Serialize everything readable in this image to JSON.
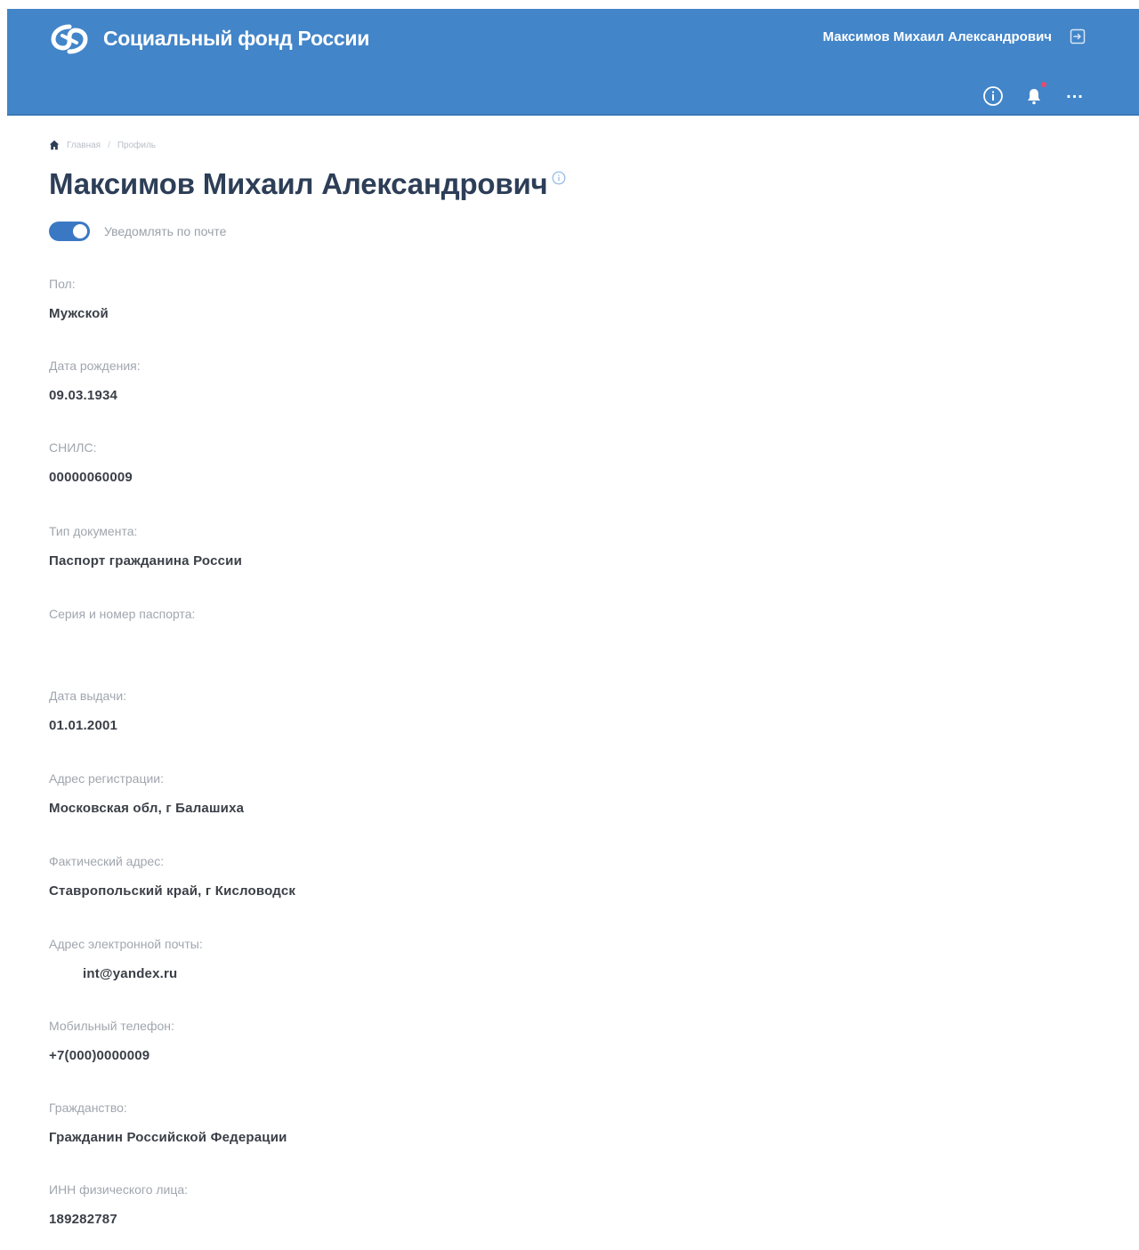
{
  "header": {
    "brand": "Социальный фонд России",
    "user_name": "Максимов Михаил Александрович",
    "icons": {
      "logo": "sfr-logo",
      "logout": "logout-icon",
      "info": "info-icon",
      "bell": "bell-icon",
      "more": "more-icon"
    },
    "more_label": "...",
    "colors": {
      "header_bg": "#4285c9",
      "notification_dot": "#e84a6b"
    }
  },
  "breadcrumb": {
    "home_icon": "home-icon",
    "items": [
      "Главная",
      "Профиль"
    ],
    "separator": "/"
  },
  "profile": {
    "title": "Максимов Михаил Александрович",
    "notify_toggle": {
      "label": "Уведомлять по почте",
      "on": true
    },
    "fields": [
      {
        "label": "Пол:",
        "value": "Мужской"
      },
      {
        "label": "Дата рождения:",
        "value": "09.03.1934"
      },
      {
        "label": "СНИЛС:",
        "value": "00000060009"
      },
      {
        "label": "Тип документа:",
        "value": "Паспорт гражданина России"
      },
      {
        "label": "Серия и номер паспорта:",
        "value": ""
      },
      {
        "label": "Дата выдачи:",
        "value": "01.01.2001"
      },
      {
        "label": "Адрес регистрации:",
        "value": "Московская обл, г Балашиха"
      },
      {
        "label": "Фактический адрес:",
        "value": "Ставропольский край, г Кисловодск"
      },
      {
        "label": "Адрес электронной почты:",
        "value": "int@yandex.ru"
      },
      {
        "label": "Мобильный телефон:",
        "value": "+7(000)0000009"
      },
      {
        "label": "Гражданство:",
        "value": "Гражданин Российской Федерации"
      },
      {
        "label": "ИНН физического лица:",
        "value": "189282787"
      }
    ]
  }
}
